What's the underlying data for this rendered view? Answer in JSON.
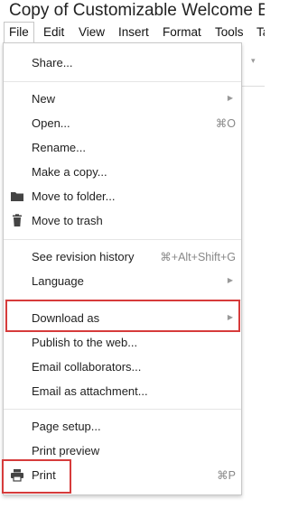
{
  "doc": {
    "title": "Copy of Customizable Welcome Ba"
  },
  "menubar": [
    "File",
    "Edit",
    "View",
    "Insert",
    "Format",
    "Tools",
    "Ta"
  ],
  "menu": {
    "share": {
      "label": "Share..."
    },
    "new": {
      "label": "New"
    },
    "open": {
      "label": "Open...",
      "shortcut": "⌘O"
    },
    "rename": {
      "label": "Rename..."
    },
    "make_copy": {
      "label": "Make a copy..."
    },
    "move_folder": {
      "label": "Move to folder..."
    },
    "move_trash": {
      "label": "Move to trash"
    },
    "revision": {
      "label": "See revision history",
      "shortcut": "⌘+Alt+Shift+G"
    },
    "language": {
      "label": "Language"
    },
    "download": {
      "label": "Download as"
    },
    "publish": {
      "label": "Publish to the web..."
    },
    "email_collab": {
      "label": "Email collaborators..."
    },
    "email_attach": {
      "label": "Email as attachment..."
    },
    "page_setup": {
      "label": "Page setup..."
    },
    "print_preview": {
      "label": "Print preview"
    },
    "print": {
      "label": "Print",
      "shortcut": "⌘P"
    }
  },
  "icons": {
    "submenu": "chevron-right-icon",
    "folder": "folder-icon",
    "trash": "trash-icon",
    "print": "printer-icon"
  },
  "colors": {
    "highlight": "#d63b3b",
    "menu_border": "#c8c8c8",
    "separator": "#e5e5e5"
  }
}
